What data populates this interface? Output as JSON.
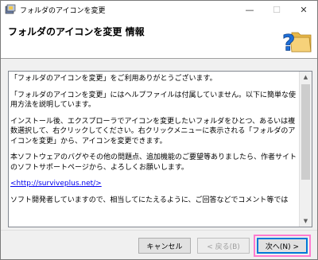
{
  "window": {
    "title": "フォルダのアイコンを変更",
    "minimize_glyph": "—",
    "maximize_glyph": "☐",
    "close_glyph": "✕"
  },
  "header": {
    "title": "フォルダのアイコンを変更 情報",
    "icon": "help-folder-icon"
  },
  "content": {
    "paragraphs": [
      "「フォルダのアイコンを変更」をご利用ありがとうございます。",
      "「フォルダのアイコンを変更」にはヘルプファイルは付属していません。以下に簡単な使用方法を説明しています。",
      "インストール後、エクスプローラでアイコンを変更したいフォルダをひとつ、あるいは複数選択して、右クリックしてください。右クリックメニューに表示される「フォルダのアイコンを変更」から、アイコンを変更できます。",
      "本ソフトウェアのバグやその他の問題点、追加機能のご要望等ありましたら、作者サイトのソフトサポートページから、よろしくお願いします。"
    ],
    "link": "<http://surviveplus.net/>",
    "cutoff_line": "ソフト開発者していますので、相当してにたえるように、ご回答などでコメント等では"
  },
  "buttons": {
    "cancel": "キャンセル",
    "back": "< 戻る(B)",
    "next": "次へ(N) >"
  },
  "colors": {
    "highlight": "#ff7bd0",
    "focus": "#0078d7"
  }
}
